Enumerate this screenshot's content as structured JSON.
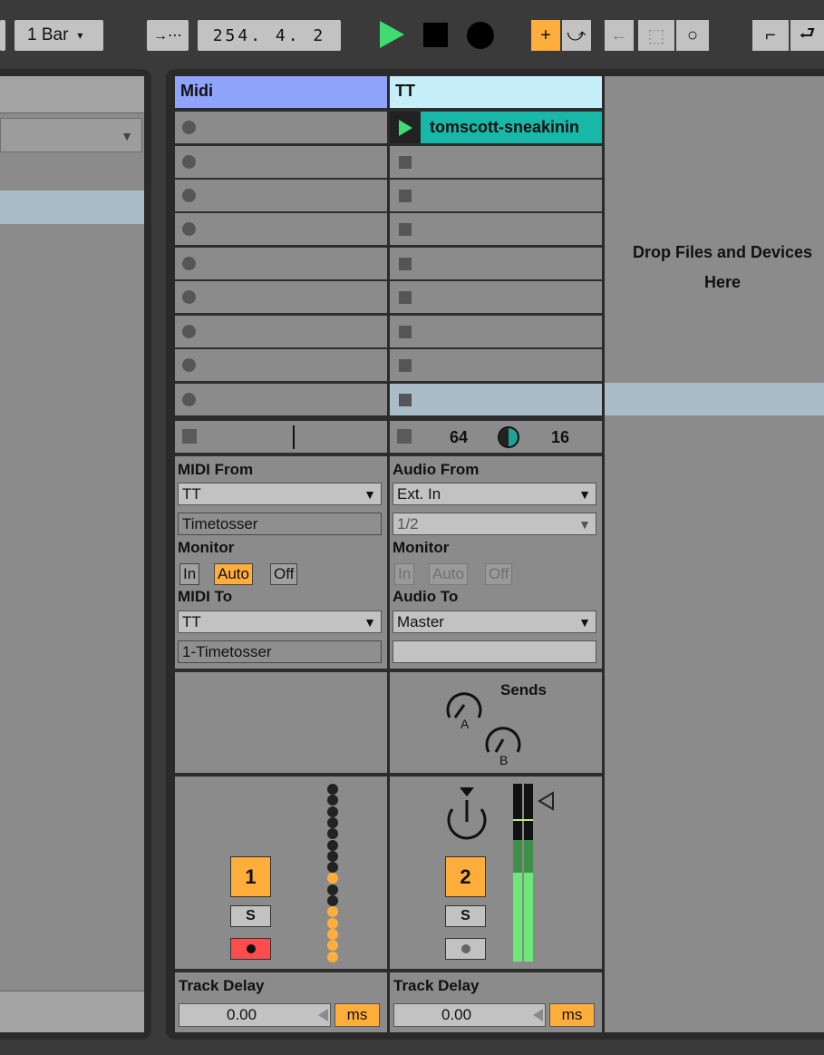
{
  "toolbar": {
    "quantization": "1 Bar",
    "quantization_caret": "▾",
    "follow_icon": "→⋯",
    "position": "254.  4.  2",
    "draw_symbol": "+",
    "curve_symbol": "⤻",
    "back_symbol": "←",
    "loop_symbol": "⬚",
    "circle_symbol": "○",
    "punch_symbol": "⌐",
    "loopback_symbol": "⮐"
  },
  "drop_area": {
    "line1": "Drop Files and Devices",
    "line2": "Here"
  },
  "tracks": [
    {
      "name": "Midi",
      "header_color": "#8fa3fb",
      "clips": [],
      "io": {
        "from_label": "MIDI From",
        "from_value": "TT",
        "from_channel": "Timetosser",
        "monitor_label": "Monitor",
        "monitor_options": [
          "In",
          "Auto",
          "Off"
        ],
        "monitor_selected": "Auto",
        "to_label": "MIDI To",
        "to_value": "TT",
        "to_channel": "1-Timetosser"
      },
      "mixer": {
        "number": "1",
        "solo": "S",
        "arm_active": true
      },
      "track_delay": {
        "label": "Track Delay",
        "value": "0.00",
        "unit": "ms"
      }
    },
    {
      "name": "TT",
      "header_color": "#c6eef9",
      "clips": [
        {
          "name": "tomscott-sneakinin",
          "color": "#18b8a8",
          "playing": true
        }
      ],
      "stop_row": {
        "value_a": "64",
        "value_b": "16"
      },
      "io": {
        "from_label": "Audio From",
        "from_value": "Ext. In",
        "from_channel": "1/2",
        "monitor_label": "Monitor",
        "monitor_options": [
          "In",
          "Auto",
          "Off"
        ],
        "monitor_selected": "",
        "to_label": "Audio To",
        "to_value": "Master",
        "to_channel": ""
      },
      "sends": {
        "title": "Sends",
        "send_a": "A",
        "send_b": "B"
      },
      "mixer": {
        "number": "2",
        "solo": "S",
        "arm_active": false,
        "meter_level": 0.5
      },
      "track_delay": {
        "label": "Track Delay",
        "value": "0.00",
        "unit": "ms"
      }
    }
  ],
  "colors": {
    "accent": "#ffad3b",
    "play_green": "#3fdc72",
    "arm_red": "#ff4c4c",
    "clip_teal": "#18b8a8",
    "selection": "#a9bcc7"
  }
}
